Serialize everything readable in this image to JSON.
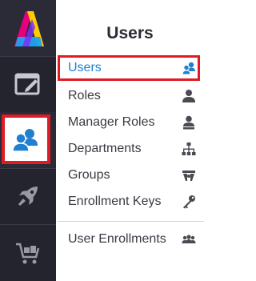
{
  "rail": {
    "items": [
      {
        "icon": "logo-icon"
      },
      {
        "icon": "edit-window-icon"
      },
      {
        "icon": "users-icon",
        "active": true
      },
      {
        "icon": "rocket-icon"
      },
      {
        "icon": "shopping-cart-icon"
      }
    ]
  },
  "panel": {
    "title": "Users",
    "items": [
      {
        "label": "Users",
        "icon": "users-icon",
        "active": true
      },
      {
        "label": "Roles",
        "icon": "user-icon"
      },
      {
        "label": "Manager Roles",
        "icon": "manager-icon"
      },
      {
        "label": "Departments",
        "icon": "org-chart-icon"
      },
      {
        "label": "Groups",
        "icon": "group-icon"
      },
      {
        "label": "Enrollment Keys",
        "icon": "key-icon"
      },
      {
        "label": "User Enrollments",
        "icon": "enrollments-icon"
      }
    ]
  },
  "colors": {
    "rail_bg": "#23242e",
    "active_text": "#1f7fd1",
    "highlight_border": "#e01b23",
    "icon_blue": "#1f7fd1",
    "icon_gray": "#4a4a52"
  }
}
